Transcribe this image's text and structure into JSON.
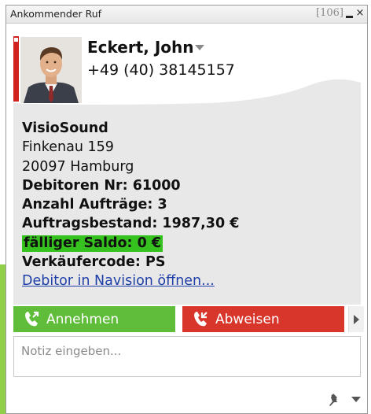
{
  "window": {
    "title": "Ankommender Ruf",
    "counter": "[106]",
    "close_label": "×"
  },
  "caller": {
    "name": "Eckert, John",
    "phone": "+49 (40) 38145157"
  },
  "details": {
    "company": "VisioSound",
    "street": "Finkenau 159",
    "city": "20097 Hamburg",
    "debtor_no": "Debitoren Nr: 61000",
    "order_count": "Anzahl Aufträge: 3",
    "order_stock": "Auftragsbestand: 1987,30 €",
    "balance_due": "fälliger Saldo: 0 €",
    "seller_code": "Verkäufercode: PS",
    "link_label": "Debitor in Navision öffnen..."
  },
  "actions": {
    "accept_label": "Annehmen",
    "reject_label": "Abweisen"
  },
  "note": {
    "placeholder": "Notiz eingeben..."
  },
  "colors": {
    "accept": "#5fbd3a",
    "reject": "#d8352b",
    "status_bar": "#d0231f",
    "saldo_highlight": "#35c21e",
    "link": "#1f3fa8",
    "panel_bg": "#e8e8e8"
  },
  "icons": {
    "accept": "phone-accept-icon",
    "reject": "phone-reject-icon",
    "more": "chevron-right-icon",
    "pin": "pin-icon",
    "dropdown": "chevron-down-icon"
  }
}
